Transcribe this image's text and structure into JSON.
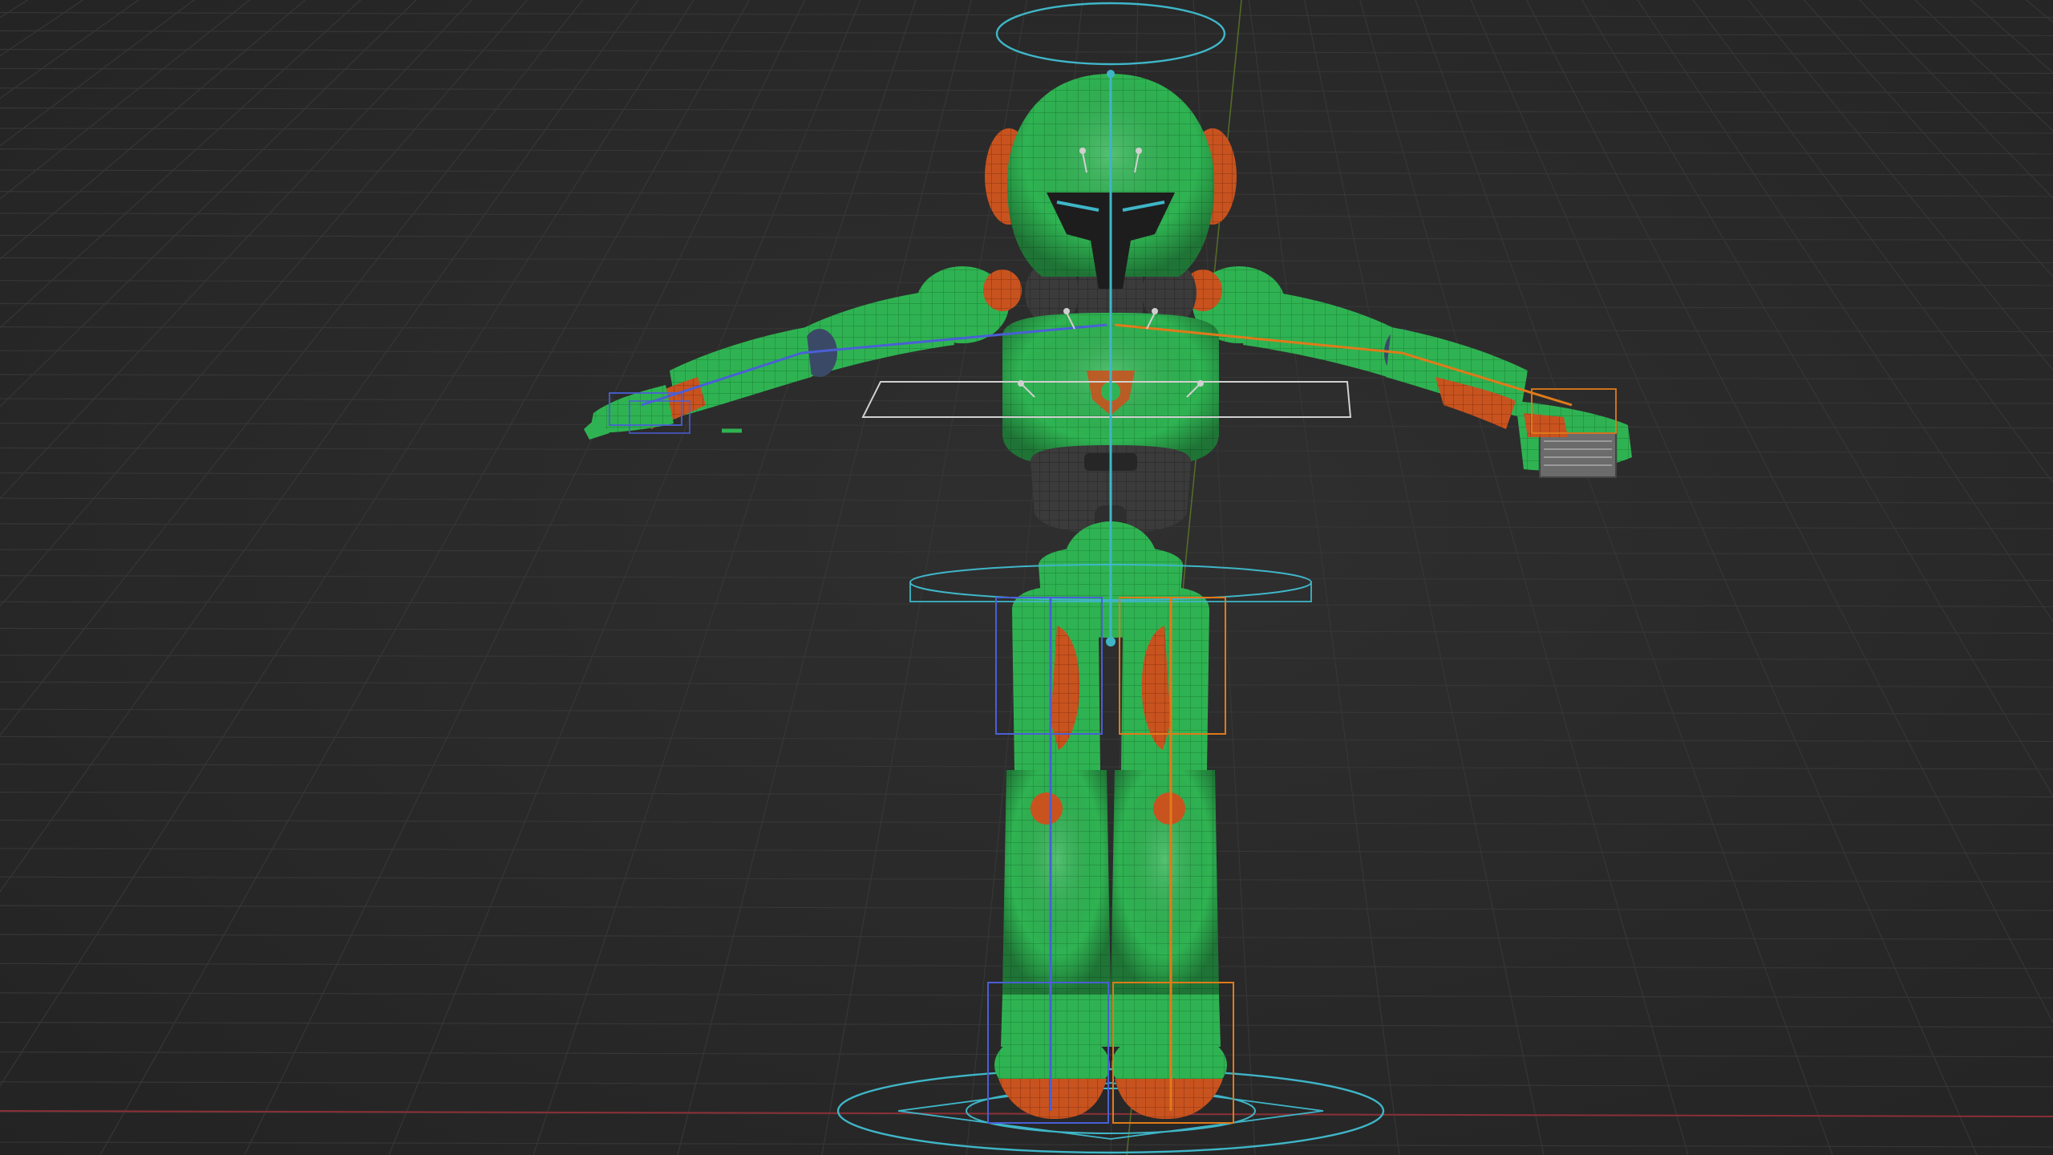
{
  "viewport": {
    "mode": "3d-viewport",
    "background_color": "#2a2a2a",
    "grid_color": "#363636",
    "x_axis_color": "#8a2f36",
    "y_axis_color": "#5f7a2a"
  },
  "scene": {
    "character": {
      "description_icon": "robot-character",
      "body_color": "#2fb352",
      "wire_color": "#1d7a35",
      "accent_color": "#c8531f",
      "dark_color": "#3a3a3a"
    },
    "rig": {
      "center_color": "#3fb6c8",
      "left_color": "#4a5fd6",
      "right_color": "#e07a1a",
      "controller_color": "#cfcfcf"
    }
  }
}
